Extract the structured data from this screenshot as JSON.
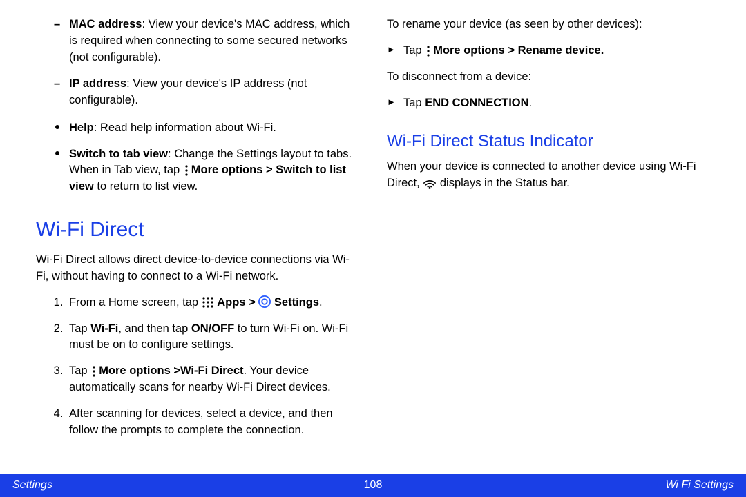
{
  "left": {
    "mac_label": "MAC address",
    "mac_text": ": View your device's MAC address, which is required when connecting to some secured networks (not configurable).",
    "ip_label": "IP address",
    "ip_text": ": View your device's IP address (not configurable).",
    "help_label": "Help",
    "help_text": ": Read help information about Wi-Fi.",
    "switch_label": "Switch to tab view",
    "switch_text_a": ": Change the Settings layout to tabs. When in Tab view, tap ",
    "more_options": "More options",
    "gt": " > ",
    "switch_list_view": "Switch to list view",
    "switch_text_b": " to return to list view.",
    "h_wifidirect": "Wi-Fi Direct",
    "wifidirect_para": "Wi-Fi Direct allows direct device-to-device connections via Wi-Fi, without having to connect to a Wi-Fi network.",
    "step1_a": "From a Home screen, tap ",
    "apps_label": "Apps",
    "settings_label": "Settings",
    "step1_dot": ".",
    "step2_a": "Tap ",
    "wifi_label": "Wi-Fi",
    "step2_b": ", and then tap ",
    "onoff_label": "ON/OFF",
    "step2_c": " to turn Wi-Fi on. Wi-Fi must be on to configure settings.",
    "step3_a": "Tap ",
    "step3_more": "More options >",
    "wifidirect_label": "Wi-Fi Direct",
    "step3_b": ". Your device automatically scans for nearby Wi-Fi Direct devices.",
    "step4": "After scanning for devices, select a device, and then follow the prompts to complete the connection."
  },
  "right": {
    "rename_intro": "To rename your device (as seen by other devices):",
    "tap_label": "Tap ",
    "more_options": "More options",
    "gt": " > ",
    "rename_device": "Rename device.",
    "disconnect_intro": "To disconnect from a device:",
    "end_connection": "END CONNECTION",
    "end_dot": ".",
    "h_status": "Wi-Fi Direct Status Indicator",
    "status_para_a": "When your device is connected to another device using Wi-Fi Direct, ",
    "status_para_b": " displays in the Status bar."
  },
  "footer": {
    "left": "Settings",
    "center": "108",
    "right": "Wi Fi Settings"
  }
}
